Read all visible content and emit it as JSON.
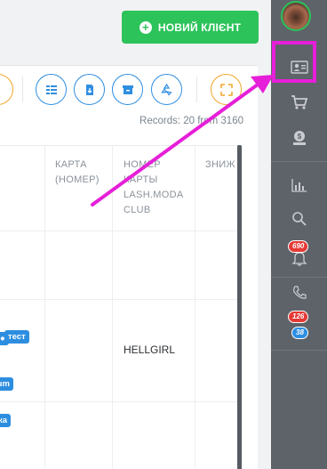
{
  "header": {
    "new_client_label": "НОВИЙ КЛІЄНТ"
  },
  "toolbar": {
    "records_label": "Records: 20 from 3160"
  },
  "table": {
    "columns": [
      {
        "label": "КАРТА (НОМЕР)"
      },
      {
        "label": "НОМЕР КАРТЫ LASH.MODA CLUB"
      },
      {
        "label": "ЗНИЖ"
      }
    ],
    "rows": [
      {
        "card": "",
        "club_card": "",
        "tags": []
      },
      {
        "card": "",
        "club_card": "HELLGIRL",
        "tags": [
          "тест",
          "ium"
        ]
      },
      {
        "card": "",
        "club_card": "",
        "tags": [
          "ка"
        ]
      }
    ]
  },
  "sidebar": {
    "notifications_count": "690",
    "calls_missed_count": "126",
    "calls_new_count": "38"
  },
  "colors": {
    "accent_green": "#2cc35a",
    "accent_blue": "#2f8ee0",
    "accent_orange": "#f4a52a",
    "sidebar_bg": "#5e636a",
    "annotation_magenta": "#e61fd8",
    "badge_red": "#e53935",
    "badge_blue": "#2d8ee0"
  },
  "icons": {
    "toolbar": [
      "columns-icon",
      "download-icon",
      "archive-icon",
      "recycle-icon",
      "fullscreen-icon"
    ],
    "sidebar": [
      "clients-icon",
      "cart-icon",
      "money-icon",
      "stats-icon",
      "search-icon",
      "bell-icon",
      "phone-icon"
    ]
  }
}
